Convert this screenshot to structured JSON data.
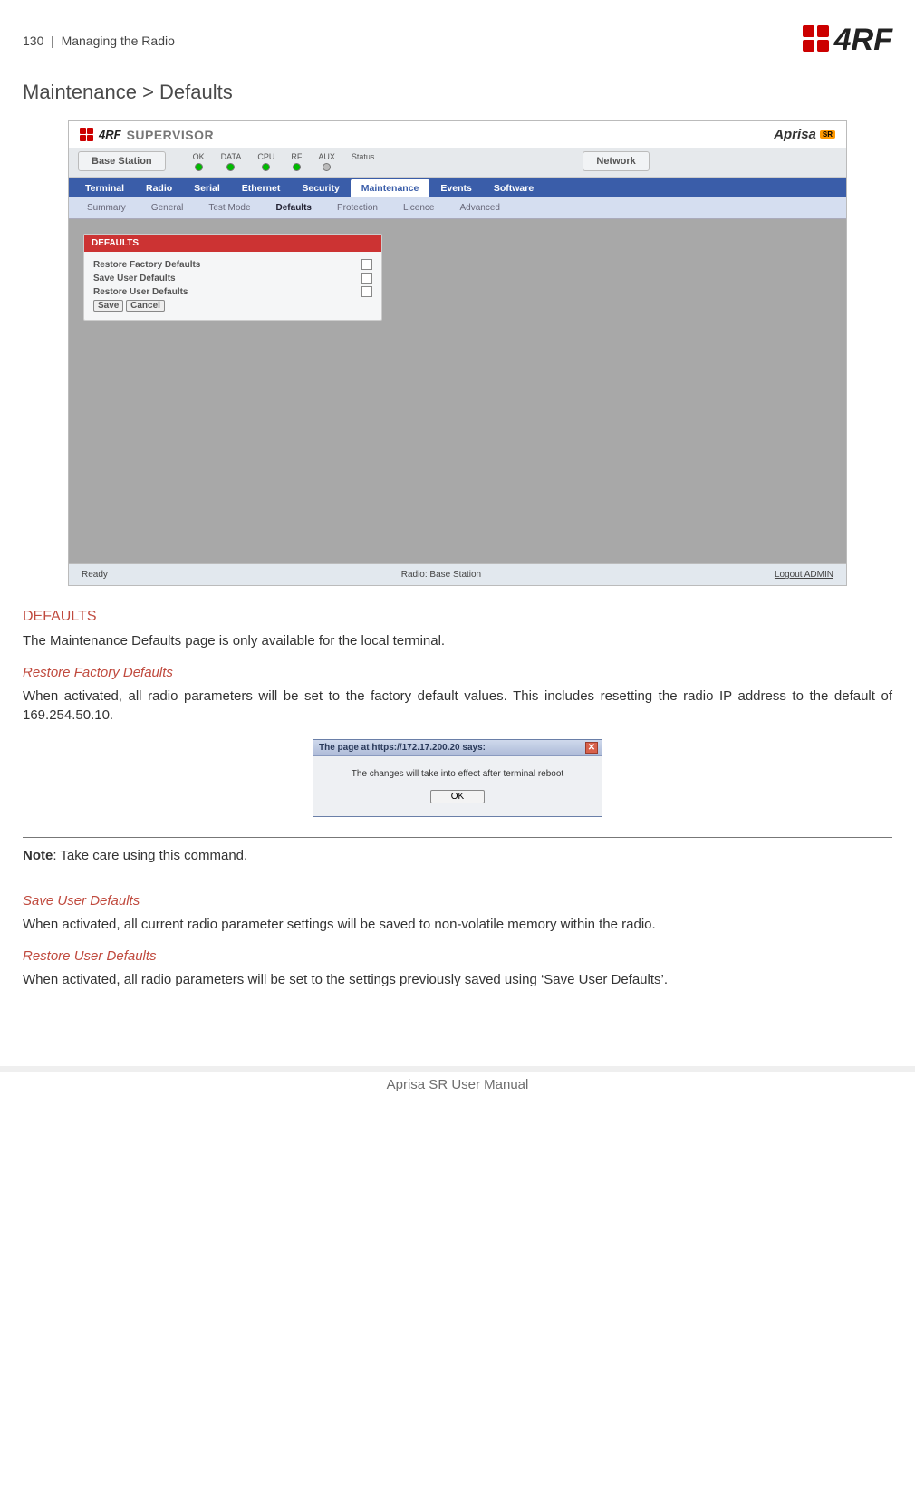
{
  "page_header": {
    "page_number": "130",
    "separator": "|",
    "section": "Managing the Radio",
    "brand": "4RF"
  },
  "title": "Maintenance > Defaults",
  "supervisor": {
    "brand": "4RF",
    "product": "SUPERVISOR",
    "aprisa": "Aprisa",
    "aprisa_badge": "SR",
    "status_left": "Base Station",
    "status_label": "Status",
    "leds": [
      "OK",
      "DATA",
      "CPU",
      "RF",
      "AUX"
    ],
    "status_right": "Network",
    "topnav": [
      "Terminal",
      "Radio",
      "Serial",
      "Ethernet",
      "Security",
      "Maintenance",
      "Events",
      "Software"
    ],
    "topnav_active": "Maintenance",
    "subnav": [
      "Summary",
      "General",
      "Test Mode",
      "Defaults",
      "Protection",
      "Licence",
      "Advanced"
    ],
    "subnav_active": "Defaults",
    "panel_title": "DEFAULTS",
    "rows": [
      "Restore Factory Defaults",
      "Save User Defaults",
      "Restore User Defaults"
    ],
    "save_btn": "Save",
    "cancel_btn": "Cancel",
    "statusbar_left": "Ready",
    "statusbar_center": "Radio: Base Station",
    "statusbar_right": "Logout ADMIN"
  },
  "doc": {
    "h_defaults": "DEFAULTS",
    "p_defaults": "The Maintenance Defaults page is only available for the local terminal.",
    "h_restore_factory": "Restore Factory Defaults",
    "p_restore_factory": "When activated, all radio parameters will be set to the factory default values. This includes resetting the radio IP address to the default of 169.254.50.10.",
    "dialog_title": "The page at https://172.17.200.20 says:",
    "dialog_body": "The changes will take into effect after terminal reboot",
    "dialog_ok": "OK",
    "note_label": "Note",
    "note_text": ": Take care using this command.",
    "h_save_user": "Save User Defaults",
    "p_save_user": "When activated, all current radio parameter settings will be saved to non-volatile memory within the radio.",
    "h_restore_user": "Restore User Defaults",
    "p_restore_user": "When activated, all radio parameters will be set to the settings previously saved using ‘Save User Defaults’."
  },
  "footer": "Aprisa SR User Manual"
}
